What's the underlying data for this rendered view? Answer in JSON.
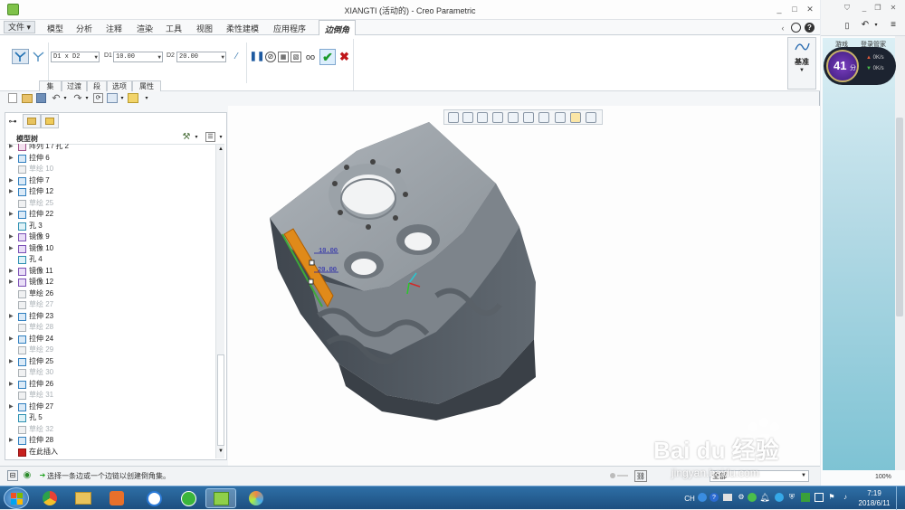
{
  "window": {
    "title": "XIANGTI (活动的) - Creo Parametric",
    "controls": [
      "_",
      "□",
      "✕"
    ]
  },
  "menu": {
    "file": "文件",
    "items": [
      "模型",
      "分析",
      "注释",
      "渲染",
      "工具",
      "视图",
      "柔性建模",
      "应用程序"
    ],
    "active_tab": "边倒角"
  },
  "ribbon": {
    "type_select": "D1 x D2",
    "d1_label": "D1",
    "d1_value": "10.00",
    "d2_label": "D2",
    "d2_value": "20.00",
    "subtabs": [
      "集",
      "过渡",
      "段",
      "选项",
      "属性"
    ],
    "datum_label": "基准"
  },
  "tree": {
    "title": "模型树",
    "items": [
      {
        "label": "阵列 1 / 孔 2",
        "expand": true,
        "dim": false,
        "icon": "pattern-icon"
      },
      {
        "label": "拉伸 6",
        "expand": true,
        "dim": false,
        "icon": "extrude-icon"
      },
      {
        "label": "草绘 10",
        "expand": false,
        "dim": true,
        "icon": "sketch-icon"
      },
      {
        "label": "拉伸 7",
        "expand": true,
        "dim": false,
        "icon": "extrude-icon"
      },
      {
        "label": "拉伸 12",
        "expand": true,
        "dim": false,
        "icon": "extrude-icon"
      },
      {
        "label": "草绘 25",
        "expand": false,
        "dim": true,
        "icon": "sketch-icon"
      },
      {
        "label": "拉伸 22",
        "expand": true,
        "dim": false,
        "icon": "extrude-icon"
      },
      {
        "label": "孔 3",
        "expand": false,
        "dim": false,
        "icon": "hole-icon"
      },
      {
        "label": "镜像 9",
        "expand": true,
        "dim": false,
        "icon": "mirror-icon"
      },
      {
        "label": "镜像 10",
        "expand": true,
        "dim": false,
        "icon": "mirror-icon"
      },
      {
        "label": "孔 4",
        "expand": false,
        "dim": false,
        "icon": "hole-icon"
      },
      {
        "label": "镜像 11",
        "expand": true,
        "dim": false,
        "icon": "mirror-icon"
      },
      {
        "label": "镜像 12",
        "expand": true,
        "dim": false,
        "icon": "mirror-icon"
      },
      {
        "label": "草绘 26",
        "expand": false,
        "dim": false,
        "icon": "sketch-icon"
      },
      {
        "label": "草绘 27",
        "expand": false,
        "dim": true,
        "icon": "sketch-icon"
      },
      {
        "label": "拉伸 23",
        "expand": true,
        "dim": false,
        "icon": "extrude-icon"
      },
      {
        "label": "草绘 28",
        "expand": false,
        "dim": true,
        "icon": "sketch-icon"
      },
      {
        "label": "拉伸 24",
        "expand": true,
        "dim": false,
        "icon": "extrude-icon"
      },
      {
        "label": "草绘 29",
        "expand": false,
        "dim": true,
        "icon": "sketch-icon"
      },
      {
        "label": "拉伸 25",
        "expand": true,
        "dim": false,
        "icon": "extrude-icon"
      },
      {
        "label": "草绘 30",
        "expand": false,
        "dim": true,
        "icon": "sketch-icon"
      },
      {
        "label": "拉伸 26",
        "expand": true,
        "dim": false,
        "icon": "extrude-icon"
      },
      {
        "label": "草绘 31",
        "expand": false,
        "dim": true,
        "icon": "sketch-icon"
      },
      {
        "label": "拉伸 27",
        "expand": true,
        "dim": false,
        "icon": "extrude-icon"
      },
      {
        "label": "孔 5",
        "expand": false,
        "dim": false,
        "icon": "hole-icon"
      },
      {
        "label": "草绘 32",
        "expand": false,
        "dim": true,
        "icon": "sketch-icon"
      },
      {
        "label": "拉伸 28",
        "expand": true,
        "dim": false,
        "icon": "extrude-icon"
      },
      {
        "label": "在此插入",
        "expand": false,
        "dim": false,
        "icon": "insert-here-icon"
      }
    ]
  },
  "viewport": {
    "dim_label_1": "10.00",
    "dim_label_2": "20.00"
  },
  "status": {
    "message": "选择一条边或一个边链以创建倒角集。",
    "filter": "全部"
  },
  "right_panel": {
    "tab_label": "游戏",
    "login_label": "登录管家",
    "speed_score": "41",
    "speed_unit": "分",
    "up_speed": "0K/s",
    "down_speed": "0K/s",
    "zoom": "100%"
  },
  "taskbar": {
    "time": "7:19",
    "date": "2018/6/11",
    "lang": "CH"
  },
  "watermark": {
    "brand": "Bai du 经验",
    "url": "jingyan.baidu.com"
  }
}
